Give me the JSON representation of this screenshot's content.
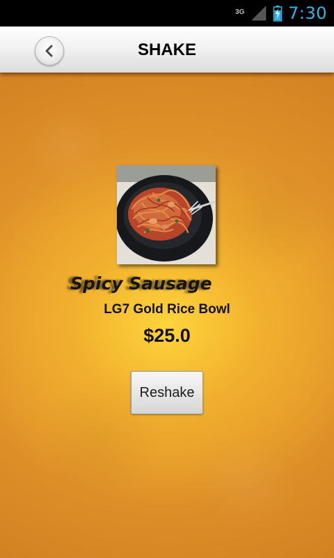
{
  "status_bar": {
    "network_type": "3G",
    "signal_icon": "signal-icon",
    "battery_icon": "battery-charging-icon",
    "time": "7:30",
    "accent_color": "#33b5e5"
  },
  "header": {
    "title": "SHAKE",
    "back_icon": "chevron-left-icon"
  },
  "result": {
    "image_icon": "food-photo",
    "dish_name": "Spicy Sausage",
    "restaurant": "LG7 Gold Rice Bowl",
    "price": "$25.0"
  },
  "actions": {
    "reshake_label": "Reshake"
  },
  "colors": {
    "background_orange": "#e39a2c",
    "background_glow": "#f7c23c"
  }
}
